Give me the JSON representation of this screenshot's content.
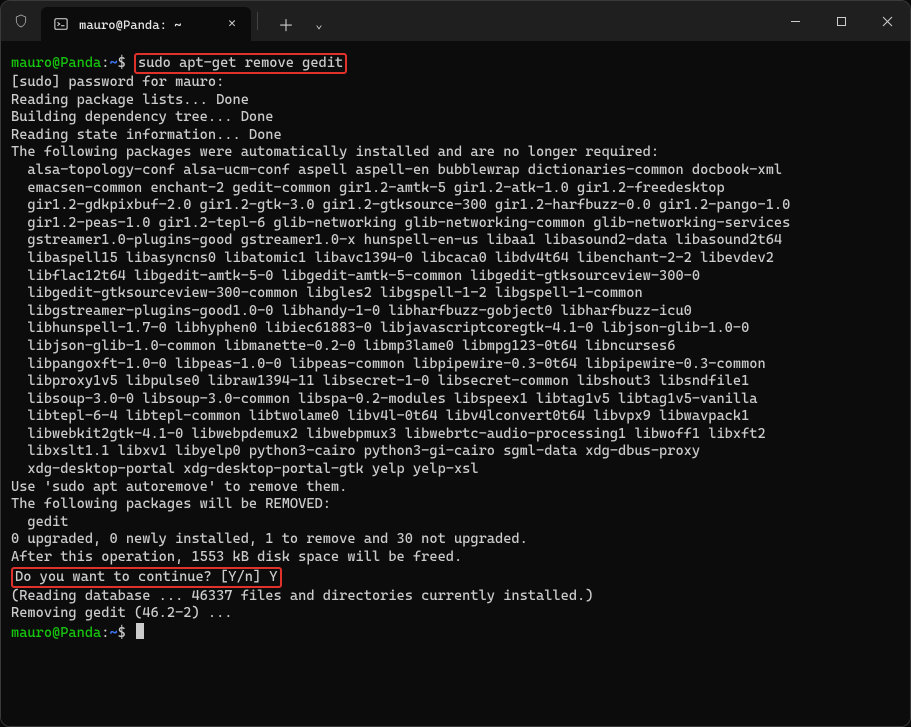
{
  "titlebar": {
    "tab_title": "mauro@Panda: ~",
    "tab_icon": "terminal-icon",
    "close_glyph": "✕",
    "newtab_glyph": "＋",
    "chevron_glyph": "⌄"
  },
  "window_controls": {
    "minimize": "−",
    "maximize": "□",
    "close": "✕"
  },
  "colors": {
    "prompt_green": "#16c60c",
    "highlight_red": "#e0312b",
    "fg": "#cccccc",
    "bg": "#0c0c0c"
  },
  "prompt": {
    "user_host": "mauro@Panda",
    "path": "~",
    "symbol": "$"
  },
  "command_highlight": "sudo apt-get remove gedit",
  "confirm_highlight": "Do you want to continue? [Y/n] Y",
  "confirm_prefix": "Do you want to continue? [Y/n] ",
  "confirm_answer": "Y",
  "output_lines": [
    "[sudo] password for mauro:",
    "Reading package lists... Done",
    "Building dependency tree... Done",
    "Reading state information... Done",
    "The following packages were automatically installed and are no longer required:",
    "  alsa-topology-conf alsa-ucm-conf aspell aspell-en bubblewrap dictionaries-common docbook-xml",
    "  emacsen-common enchant-2 gedit-common gir1.2-amtk-5 gir1.2-atk-1.0 gir1.2-freedesktop",
    "  gir1.2-gdkpixbuf-2.0 gir1.2-gtk-3.0 gir1.2-gtksource-300 gir1.2-harfbuzz-0.0 gir1.2-pango-1.0",
    "  gir1.2-peas-1.0 gir1.2-tepl-6 glib-networking glib-networking-common glib-networking-services",
    "  gstreamer1.0-plugins-good gstreamer1.0-x hunspell-en-us libaa1 libasound2-data libasound2t64",
    "  libaspell15 libasyncns0 libatomic1 libavc1394-0 libcaca0 libdv4t64 libenchant-2-2 libevdev2",
    "  libflac12t64 libgedit-amtk-5-0 libgedit-amtk-5-common libgedit-gtksourceview-300-0",
    "  libgedit-gtksourceview-300-common libgles2 libgspell-1-2 libgspell-1-common",
    "  libgstreamer-plugins-good1.0-0 libhandy-1-0 libharfbuzz-gobject0 libharfbuzz-icu0",
    "  libhunspell-1.7-0 libhyphen0 libiec61883-0 libjavascriptcoregtk-4.1-0 libjson-glib-1.0-0",
    "  libjson-glib-1.0-common libmanette-0.2-0 libmp3lame0 libmpg123-0t64 libncurses6",
    "  libpangoxft-1.0-0 libpeas-1.0-0 libpeas-common libpipewire-0.3-0t64 libpipewire-0.3-common",
    "  libproxy1v5 libpulse0 libraw1394-11 libsecret-1-0 libsecret-common libshout3 libsndfile1",
    "  libsoup-3.0-0 libsoup-3.0-common libspa-0.2-modules libspeex1 libtag1v5 libtag1v5-vanilla",
    "  libtepl-6-4 libtepl-common libtwolame0 libv4l-0t64 libv4lconvert0t64 libvpx9 libwavpack1",
    "  libwebkit2gtk-4.1-0 libwebpdemux2 libwebpmux3 libwebrtc-audio-processing1 libwoff1 libxft2",
    "  libxslt1.1 libxv1 libyelp0 python3-cairo python3-gi-cairo sgml-data xdg-dbus-proxy",
    "  xdg-desktop-portal xdg-desktop-portal-gtk yelp yelp-xsl",
    "Use 'sudo apt autoremove' to remove them.",
    "The following packages will be REMOVED:",
    "  gedit",
    "0 upgraded, 0 newly installed, 1 to remove and 30 not upgraded.",
    "After this operation, 1553 kB disk space will be freed."
  ],
  "post_confirm_lines": [
    "(Reading database ... 46337 files and directories currently installed.)",
    "Removing gedit (46.2-2) ..."
  ]
}
